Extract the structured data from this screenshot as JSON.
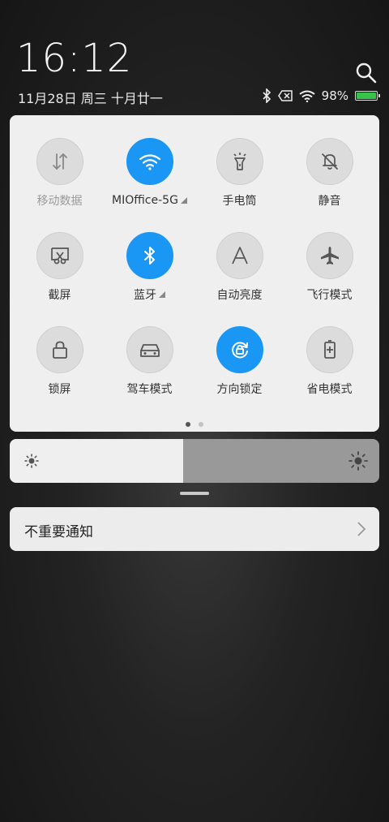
{
  "status": {
    "time": "16:12",
    "date": "11月28日 周三 十月廿一",
    "battery_percent": "98%",
    "battery_level": 0.98
  },
  "tiles": [
    {
      "label": "移动数据",
      "icon": "mobile-data-icon",
      "state": "disabled",
      "more": false
    },
    {
      "label": "MIOffice-5G",
      "icon": "wifi-icon",
      "state": "on",
      "more": true
    },
    {
      "label": "手电筒",
      "icon": "flashlight-icon",
      "state": "off",
      "more": false
    },
    {
      "label": "静音",
      "icon": "mute-bell-icon",
      "state": "off",
      "more": false
    },
    {
      "label": "截屏",
      "icon": "screenshot-icon",
      "state": "off",
      "more": false
    },
    {
      "label": "蓝牙",
      "icon": "bluetooth-icon",
      "state": "on",
      "more": true
    },
    {
      "label": "自动亮度",
      "icon": "auto-brightness-icon",
      "state": "off",
      "more": false
    },
    {
      "label": "飞行模式",
      "icon": "airplane-icon",
      "state": "off",
      "more": false
    },
    {
      "label": "锁屏",
      "icon": "lock-icon",
      "state": "off",
      "more": false
    },
    {
      "label": "驾车模式",
      "icon": "car-icon",
      "state": "off",
      "more": false
    },
    {
      "label": "方向锁定",
      "icon": "rotation-lock-icon",
      "state": "on",
      "more": false
    },
    {
      "label": "省电模式",
      "icon": "battery-saver-icon",
      "state": "off",
      "more": false
    }
  ],
  "pager": {
    "count": 2,
    "active": 0
  },
  "brightness": {
    "level": 0.47
  },
  "notification": {
    "label": "不重要通知"
  },
  "colors": {
    "accent": "#1a96f5",
    "battery": "#37c24c"
  }
}
